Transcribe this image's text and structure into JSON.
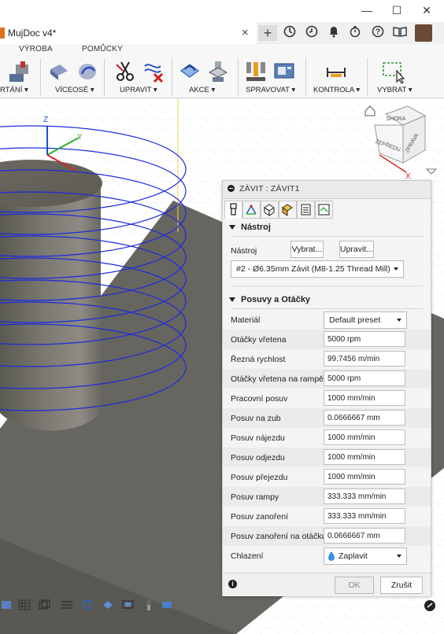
{
  "window": {
    "minimize": "—",
    "maximize": "☐",
    "close": "✕"
  },
  "tabs": {
    "doc_title": "MujDoc v4*",
    "close_glyph": "×",
    "new_tab_glyph": "+"
  },
  "ribbon": {
    "tab_names": [
      "VÝROBA",
      "POMŮCKY"
    ],
    "groups": [
      "RTÁNÍ ▾",
      "VÍCEOSÉ ▾",
      "UPRAVIT ▾",
      "AKCE ▾",
      "SPRAVOVAT ▾",
      "KONTROLA ▾",
      "VYBRAT ▾"
    ]
  },
  "viewport": {
    "axis_z": "Z",
    "axis_y": "Y",
    "axis_x": "X",
    "viewcube_faces": [
      "SHORA",
      "ZEPŘEDU",
      "ZPRAVA"
    ]
  },
  "dialog": {
    "title": "ZÁVIT : ZÁVIT1",
    "tool_section": {
      "heading": "Nástroj",
      "tool_label": "Nástroj",
      "select_button": "Vybrat...",
      "edit_button": "Upravit...",
      "tool_value": "#2 - Ø6.35mm Závit (M8-1.25 Thread Mill)"
    },
    "feeds_section": {
      "heading": "Posuvy a Otáčky",
      "material_label": "Materiál",
      "material_value": "Default preset",
      "rows": [
        {
          "label": "Otáčky vřetena",
          "value": "5000 rpm"
        },
        {
          "label": "Řezná rychlost",
          "value": "99.7456 m/min"
        },
        {
          "label": "Otáčky vřetena na rampě",
          "value": "5000 rpm"
        },
        {
          "label": "Pracovní posuv",
          "value": "1000 mm/min"
        },
        {
          "label": "Posuv na zub",
          "value": "0.0666667 mm"
        },
        {
          "label": "Posuv nájezdu",
          "value": "1000 mm/min"
        },
        {
          "label": "Posuv odjezdu",
          "value": "1000 mm/min"
        },
        {
          "label": "Posuv přejezdu",
          "value": "1000 mm/min"
        },
        {
          "label": "Posuv rampy",
          "value": "333.333 mm/min"
        },
        {
          "label": "Posuv zanoření",
          "value": "333.333 mm/min"
        },
        {
          "label": "Posuv zanoření na otáčku",
          "value": "0.0666667 mm"
        }
      ],
      "coolant_label": "Chlazení",
      "coolant_value": "Zaplavit"
    },
    "ok_button": "OK",
    "cancel_button": "Zrušit",
    "info_glyph": "i"
  },
  "colors": {
    "accent_blue": "#1a4fd6",
    "toolpath_blue": "#1d2bdb",
    "part_gray": "#7d7b74",
    "cube_red": "#d62828"
  }
}
